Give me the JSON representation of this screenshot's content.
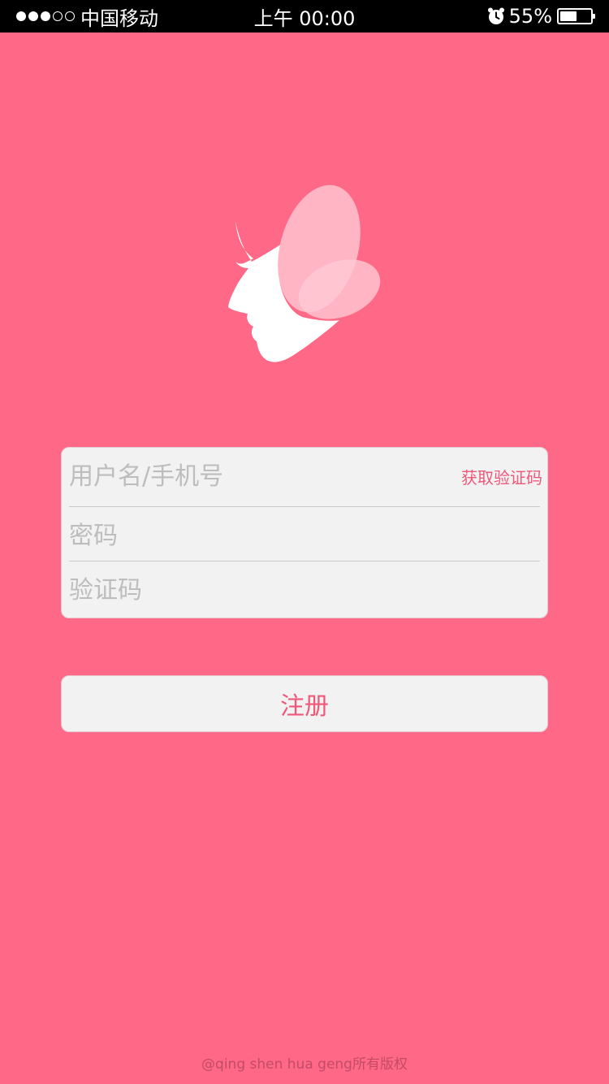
{
  "status_bar": {
    "signal_filled": 3,
    "signal_total": 5,
    "carrier": "中国移动",
    "time": "上午 00:00",
    "battery_text": "55%",
    "battery_level": 0.55
  },
  "form": {
    "username_placeholder": "用户名/手机号",
    "get_code_label": "获取验证码",
    "password_placeholder": "密码",
    "code_placeholder": "验证码"
  },
  "register_label": "注册",
  "footer": {
    "copyright": "@qing shen hua geng所有版权"
  },
  "colors": {
    "background": "#FF6886",
    "card": "#F2F2F2",
    "accent": "#F0587A"
  },
  "icons": {
    "logo": "butterfly-face-logo",
    "alarm": "alarm-clock-icon",
    "battery": "battery-icon"
  }
}
